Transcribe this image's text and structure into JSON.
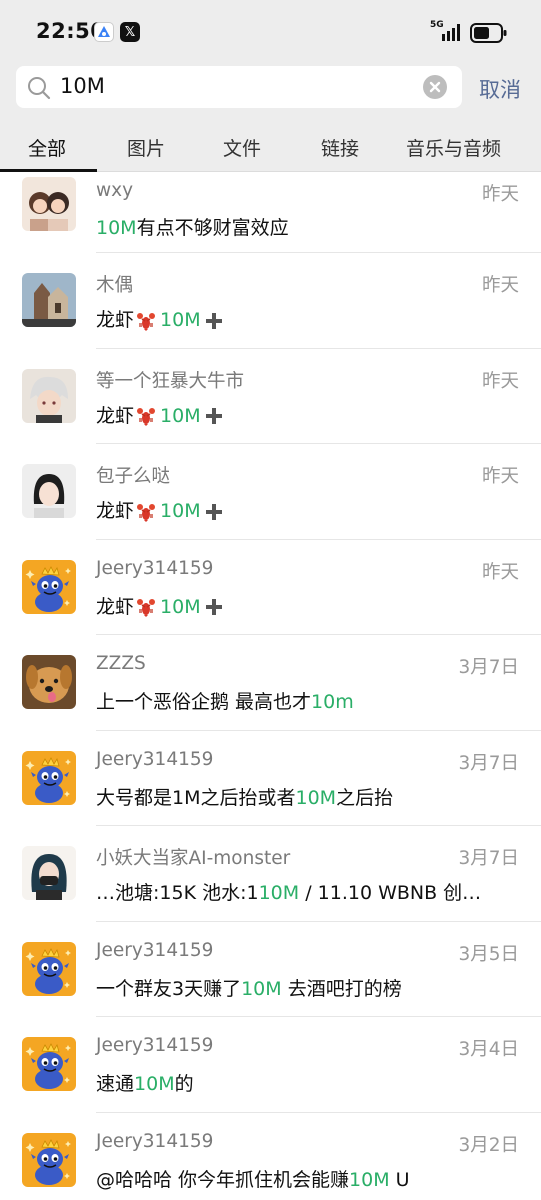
{
  "status_bar": {
    "time": "22:50",
    "network": "5G",
    "icons": [
      "assistant-app-icon",
      "x-app-icon",
      "signal-icon",
      "battery-icon"
    ]
  },
  "search": {
    "query": "10M",
    "cancel_label": "取消",
    "icons": [
      "search-icon",
      "clear-icon"
    ]
  },
  "tabs": [
    {
      "label": "全部",
      "active": true
    },
    {
      "label": "图片",
      "active": false
    },
    {
      "label": "文件",
      "active": false
    },
    {
      "label": "链接",
      "active": false
    },
    {
      "label": "音乐与音频",
      "active": false
    }
  ],
  "colors": {
    "highlight": "#2aae67",
    "link_blue": "#576b95",
    "top_background": "#ededed"
  },
  "results": [
    {
      "name": "wxy",
      "date": "昨天",
      "avatar_icon": "couple-avatar",
      "msg_before": "",
      "match": "10M",
      "msg_after": "有点不够财富效应"
    },
    {
      "name": "木偶",
      "date": "昨天",
      "avatar_icon": "building-avatar",
      "msg_before": "龙虾",
      "emoji": "lobster-emoji",
      "match": "10M",
      "plus_icon": "plus-icon",
      "msg_after": ""
    },
    {
      "name": "等一个狂暴大牛市",
      "date": "昨天",
      "avatar_icon": "anime-avatar",
      "msg_before": "龙虾",
      "emoji": "lobster-emoji",
      "match": "10M",
      "plus_icon": "plus-icon",
      "msg_after": ""
    },
    {
      "name": "包子么哒",
      "date": "昨天",
      "avatar_icon": "girl-avatar",
      "msg_before": "龙虾",
      "emoji": "lobster-emoji",
      "match": "10M",
      "plus_icon": "plus-icon",
      "msg_after": ""
    },
    {
      "name": "Jeery314159",
      "date": "昨天",
      "avatar_icon": "dragon-avatar",
      "msg_before": "龙虾",
      "emoji": "lobster-emoji",
      "match": "10M",
      "plus_icon": "plus-icon",
      "msg_after": ""
    },
    {
      "name": "ZZZS",
      "date": "3月7日",
      "avatar_icon": "dog-avatar",
      "msg_before": "上一个恶俗企鹅 最高也才",
      "match": "10m",
      "msg_after": ""
    },
    {
      "name": "Jeery314159",
      "date": "3月7日",
      "avatar_icon": "dragon-avatar",
      "msg_before": "大号都是1M之后抬或者",
      "match": "10M",
      "msg_after": "之后抬"
    },
    {
      "name": "小妖大当家AI-monster",
      "date": "3月7日",
      "avatar_icon": "masked-girl-avatar",
      "msg_before": "…池塘:15K 池水:1",
      "match": "10M",
      "msg_after": " / 11.10 WBNB 创…"
    },
    {
      "name": "Jeery314159",
      "date": "3月5日",
      "avatar_icon": "dragon-avatar",
      "msg_before": "一个群友3天赚了",
      "match": "10M",
      "msg_after": " 去酒吧打的榜"
    },
    {
      "name": "Jeery314159",
      "date": "3月4日",
      "avatar_icon": "dragon-avatar",
      "msg_before": "速通",
      "match": "10M",
      "msg_after": "的"
    },
    {
      "name": "Jeery314159",
      "date": "3月2日",
      "avatar_icon": "dragon-avatar",
      "msg_before": "@哈哈哈 你今年抓住机会能赚",
      "match": "10M",
      "msg_after": " U"
    }
  ]
}
